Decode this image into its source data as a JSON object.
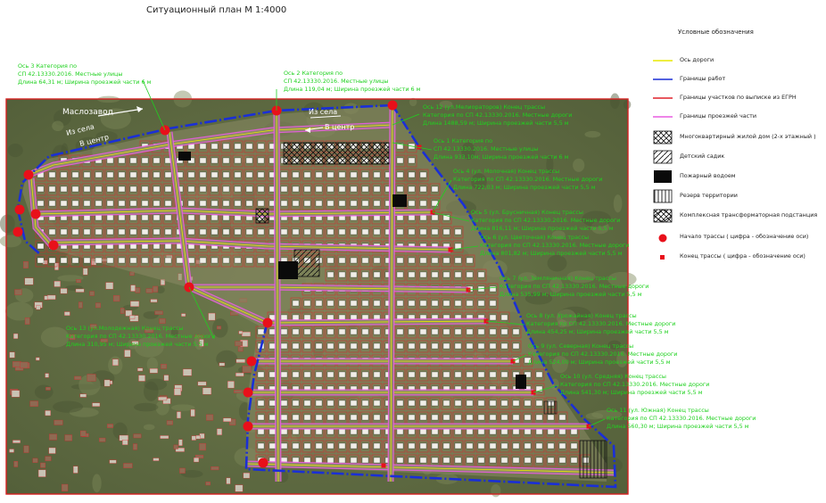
{
  "title": "Ситуационный план М 1:4000",
  "legend": {
    "title": "Условные обозначения",
    "items": [
      {
        "label": "Ось дороги",
        "kind": "line",
        "color": "#e8e800"
      },
      {
        "label": "Границы работ",
        "kind": "line",
        "color": "#1a2fd6"
      },
      {
        "label": "Границы участков по выписке из ЕГРН",
        "kind": "line",
        "color": "#e0202a"
      },
      {
        "label": "Границы проезжей части",
        "kind": "line",
        "color": "#e85de0"
      },
      {
        "label": "Многоквартирный жилой дом (2-х этажный )",
        "kind": "crosshatch"
      },
      {
        "label": "Детский садик",
        "kind": "hatch"
      },
      {
        "label": "Пожарный водоем",
        "kind": "solid"
      },
      {
        "label": "Резерв территории",
        "kind": "vlines"
      },
      {
        "label": "Комплексная трансформаторная подстанция",
        "kind": "ktp"
      },
      {
        "label": "Начало трассы ( цифра - обозначение оси)",
        "kind": "reddot"
      },
      {
        "label": "Конец трассы ( цифра - обозначение оси)",
        "kind": "redsquare"
      }
    ]
  },
  "places": {
    "maslozavod": "Маслозавод",
    "iz_sela": "Из села",
    "v_centr": "В центр"
  },
  "callouts": [
    {
      "text": [
        "Ось 3  Категория по",
        "СП 42.13330.2016. Местные улицы",
        "Длина 64,31 м; Ширина  проезжей части  6 м"
      ]
    },
    {
      "text": [
        "Ось 2  Категория по",
        "СП 42.13330.2016. Местные улицы",
        "Длина 119,04 м; Ширина  проезжей части  6 м"
      ]
    },
    {
      "text": [
        "Ось 12 (ул.Мелиораторов)  Конец трассы",
        "Категория по СП 42.13330.2016.  Местные дороги",
        "Длина 1488,59 м; Ширина  проезжей части  5,5 м"
      ]
    },
    {
      "text": [
        "Ось 1  Категория по",
        "СП 42.13330.2016. Местные улицы",
        "Длина 933,10м; Ширина  проезжей части  6 м"
      ]
    },
    {
      "text": [
        "Ось 4 (ул. Молочная)  Конец трассы",
        "Категория по СП 42.13330.2016.  Местные дороги",
        "Длина 722,03 м; Ширина  проезжей части  5,5 м"
      ]
    },
    {
      "text": [
        "Ось 5 (ул. Брусничная)  Конец трассы",
        "Категория по СП 42.13330.2016.  Местные дороги",
        "Длина 816,11 м; Ширина  проезжей части  5,5 м"
      ]
    },
    {
      "text": [
        "Ось 6 (ул. Цветочная)  Конец трассы",
        "Категория по СП 42.13330.2016.  Местные дороги",
        "Длина 801,82 м; Ширина  проезжей части  5,5 м"
      ]
    },
    {
      "text": [
        "Ось 7 (ул. Земляничная)  Конец трассы",
        "Категория по СП 42.13330.2016.  Местные дороги",
        "Длина 535,99 м; Ширина  проезжей части  5,5 м"
      ]
    },
    {
      "text": [
        "Ось 8 (ул. Урожайная)  Конец трассы",
        "Категория по СП 42.13330.2016.  Местные дороги",
        "Длина 454,25 м; Ширина  проезжей части  5,5 м"
      ]
    },
    {
      "text": [
        "Ось 9 (ул. Северная)  Конец трассы",
        "Категория по СП 42.13330.2016.  Местные дороги",
        "Длина 524,00 м; Ширина  проезжей части  5,5 м"
      ]
    },
    {
      "text": [
        "Ось 10 (ул. Средняя)  Конец трассы",
        "Категория по СП 42.13330.2016.  Местные дороги",
        "Длина 541,30 м; Ширина  проезжей части  5,5 м"
      ]
    },
    {
      "text": [
        "Ось 11 (ул. Южная)  Конец трассы",
        "Категория по СП 42.13330.2016.  Местные дороги",
        "Длина 560,30 м; Ширина  проезжей части  5,5 м"
      ]
    },
    {
      "text": [
        "Ось 13 (ул.Молодежная)  Конец трассы",
        "Категория по СП 42.13330.2016.  Местные дороги",
        "Длина 310,95 м; Ширина  проезжей части  5,5 м"
      ]
    }
  ],
  "colors": {
    "work_boundary": "#1a2fd6",
    "lot_boundary": "#e0202a",
    "roadway": "#e85de0",
    "axis": "#e8e800",
    "callout": "#1fd11f",
    "point": "#e8101a"
  }
}
